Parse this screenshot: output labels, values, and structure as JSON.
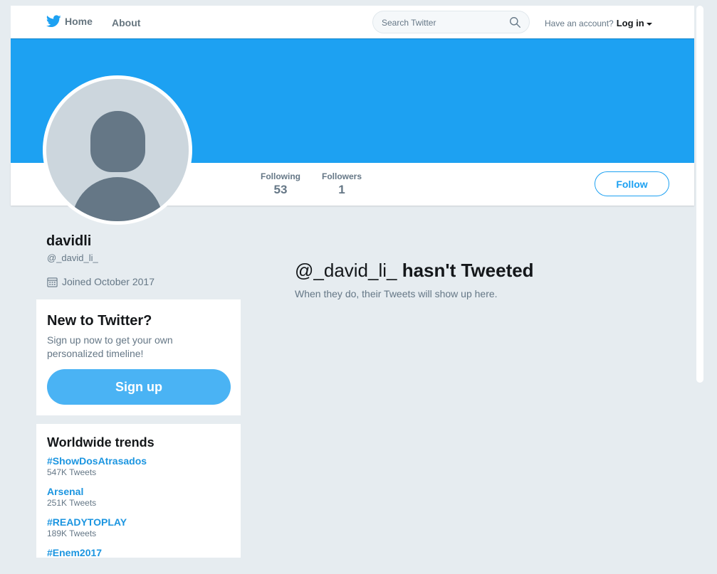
{
  "nav": {
    "home_label": "Home",
    "about_label": "About",
    "search_placeholder": "Search Twitter",
    "account_prompt": "Have an account?",
    "login_label": "Log in"
  },
  "profile": {
    "name": "davidli",
    "handle": "@_david_li_",
    "joined": "Joined October 2017",
    "banner_color": "#1da1f2"
  },
  "stats": {
    "following_label": "Following",
    "following_value": "53",
    "followers_label": "Followers",
    "followers_value": "1"
  },
  "follow_button": "Follow",
  "empty_state": {
    "handle": "@_david_li_",
    "title": "hasn't Tweeted",
    "text": "When they do, their Tweets will show up here."
  },
  "signup": {
    "title": "New to Twitter?",
    "text": "Sign up now to get your own personalized timeline!",
    "button": "Sign up"
  },
  "trends": {
    "title": "Worldwide trends",
    "items": [
      {
        "name": "#ShowDosAtrasados",
        "count": "547K Tweets"
      },
      {
        "name": "Arsenal",
        "count": "251K Tweets"
      },
      {
        "name": "#READYTOPLAY",
        "count": "189K Tweets"
      },
      {
        "name": "#Enem2017",
        "count": ""
      }
    ]
  },
  "colors": {
    "accent": "#1da1f2",
    "background": "#e6ecf0"
  }
}
